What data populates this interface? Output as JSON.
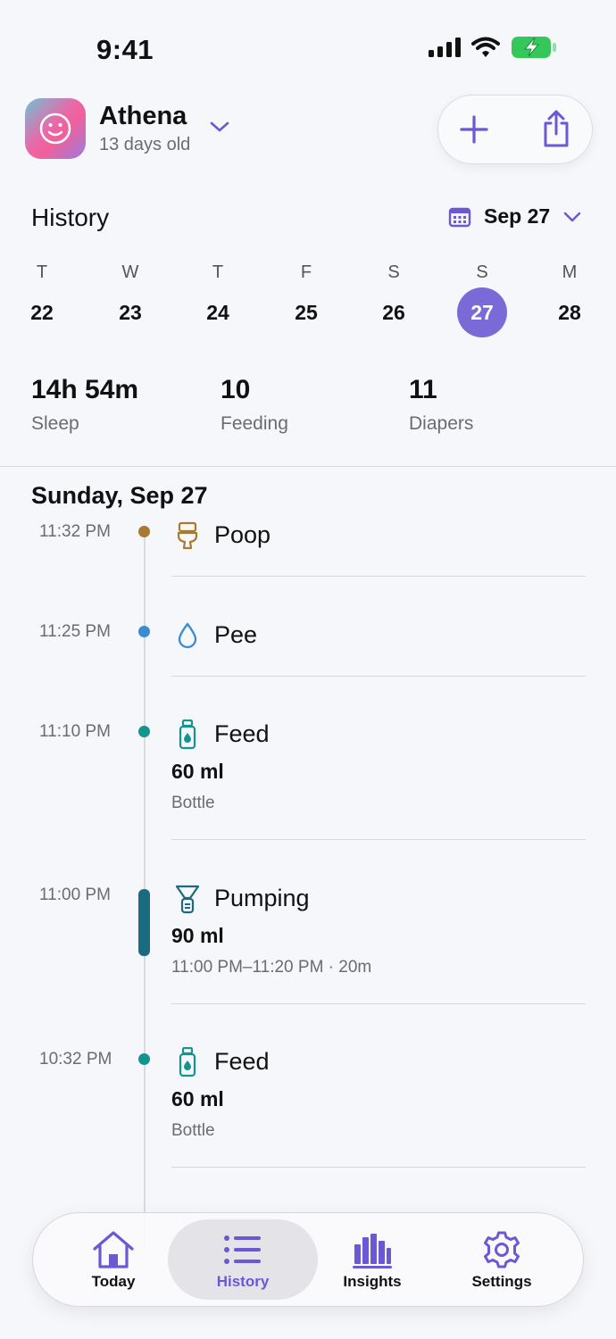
{
  "status_bar": {
    "time": "9:41"
  },
  "profile": {
    "name": "Athena",
    "age": "13 days old"
  },
  "history": {
    "title": "History",
    "selected_date": "Sep 27"
  },
  "week": [
    {
      "letter": "T",
      "num": "22"
    },
    {
      "letter": "W",
      "num": "23"
    },
    {
      "letter": "T",
      "num": "24"
    },
    {
      "letter": "F",
      "num": "25"
    },
    {
      "letter": "S",
      "num": "26"
    },
    {
      "letter": "S",
      "num": "27",
      "selected": true
    },
    {
      "letter": "M",
      "num": "28"
    }
  ],
  "summary": [
    {
      "value": "14h 54m",
      "label": "Sleep"
    },
    {
      "value": "10",
      "label": "Feeding"
    },
    {
      "value": "11",
      "label": "Diapers"
    }
  ],
  "day_heading": "Sunday, Sep 27",
  "events": [
    {
      "time": "11:32 PM",
      "title": "Poop",
      "icon": "toilet-icon",
      "color": "#a87a2e"
    },
    {
      "time": "11:25 PM",
      "title": "Pee",
      "icon": "droplet-icon",
      "color": "#3b8ad4"
    },
    {
      "time": "11:10 PM",
      "title": "Feed",
      "icon": "bottle-icon",
      "color": "#14948e",
      "amount": "60 ml",
      "sub": "Bottle"
    },
    {
      "time": "11:00 PM",
      "title": "Pumping",
      "icon": "pump-icon",
      "color": "#1a6a80",
      "amount": "90 ml",
      "sub": "11:00 PM–11:20 PM · 20m"
    },
    {
      "time": "10:32 PM",
      "title": "Feed",
      "icon": "bottle-icon",
      "color": "#14948e",
      "amount": "60 ml",
      "sub": "Bottle"
    }
  ],
  "tabs": [
    {
      "label": "Today",
      "icon": "home-icon"
    },
    {
      "label": "History",
      "icon": "list-icon",
      "active": true
    },
    {
      "label": "Insights",
      "icon": "bar-chart-icon"
    },
    {
      "label": "Settings",
      "icon": "gear-icon"
    }
  ],
  "colors": {
    "accent": "#6a58d4",
    "selected_day": "#7a6ad8",
    "battery": "#34c759"
  }
}
